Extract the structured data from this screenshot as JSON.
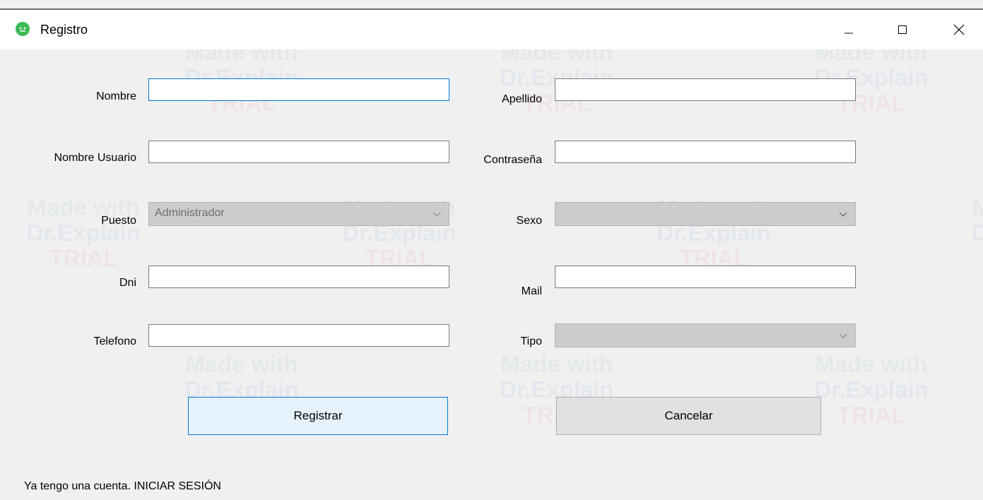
{
  "window": {
    "title": "Registro"
  },
  "watermark": {
    "line1": "Made with",
    "line2": "Dr.Explain",
    "line3": "TRIAL"
  },
  "form": {
    "nombre": {
      "label": "Nombre",
      "value": ""
    },
    "apellido": {
      "label": "Apellido",
      "value": ""
    },
    "usuario": {
      "label": "Nombre Usuario",
      "value": ""
    },
    "contrasena": {
      "label": "Contraseña",
      "value": ""
    },
    "puesto": {
      "label": "Puesto",
      "value": "Administrador"
    },
    "sexo": {
      "label": "Sexo",
      "value": ""
    },
    "dni": {
      "label": "Dni",
      "value": ""
    },
    "mail": {
      "label": "Mail",
      "value": ""
    },
    "telefono": {
      "label": "Telefono",
      "value": ""
    },
    "tipo": {
      "label": "Tipo",
      "value": ""
    }
  },
  "buttons": {
    "register": "Registrar",
    "cancel": "Cancelar"
  },
  "footer": {
    "login_link": "Ya tengo una cuenta. INICIAR SESIÓN"
  },
  "colors": {
    "accent": "#0078d7",
    "app_icon": "#3cba54"
  }
}
